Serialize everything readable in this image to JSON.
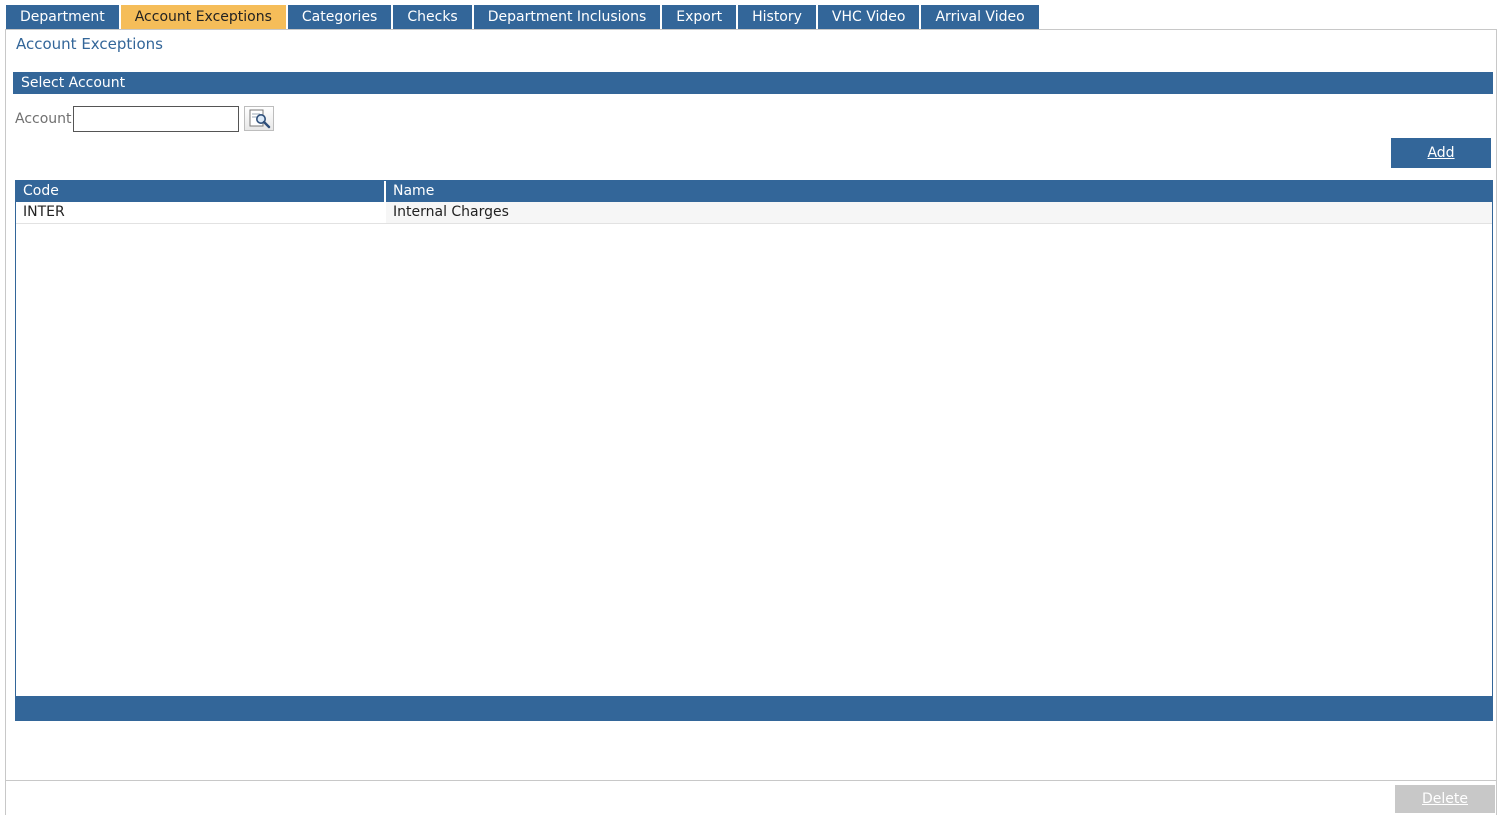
{
  "tabs": [
    {
      "label": "Department",
      "active": false
    },
    {
      "label": "Account Exceptions",
      "active": true
    },
    {
      "label": "Categories",
      "active": false
    },
    {
      "label": "Checks",
      "active": false
    },
    {
      "label": "Department Inclusions",
      "active": false
    },
    {
      "label": "Export",
      "active": false
    },
    {
      "label": "History",
      "active": false
    },
    {
      "label": "VHC Video",
      "active": false
    },
    {
      "label": "Arrival Video",
      "active": false
    }
  ],
  "page_title": "Account Exceptions",
  "section": {
    "title": "Select Account"
  },
  "account": {
    "label": "Account",
    "value": "",
    "lookup_icon": "search-document-icon"
  },
  "add_button": "Add",
  "grid": {
    "columns": [
      "Code",
      "Name"
    ],
    "rows": [
      {
        "code": "INTER",
        "name": "Internal Charges"
      }
    ]
  },
  "delete_button": "Delete",
  "colors": {
    "primary": "#336699",
    "active_tab": "#f5bd59",
    "disabled_button": "#c8c8c8"
  }
}
